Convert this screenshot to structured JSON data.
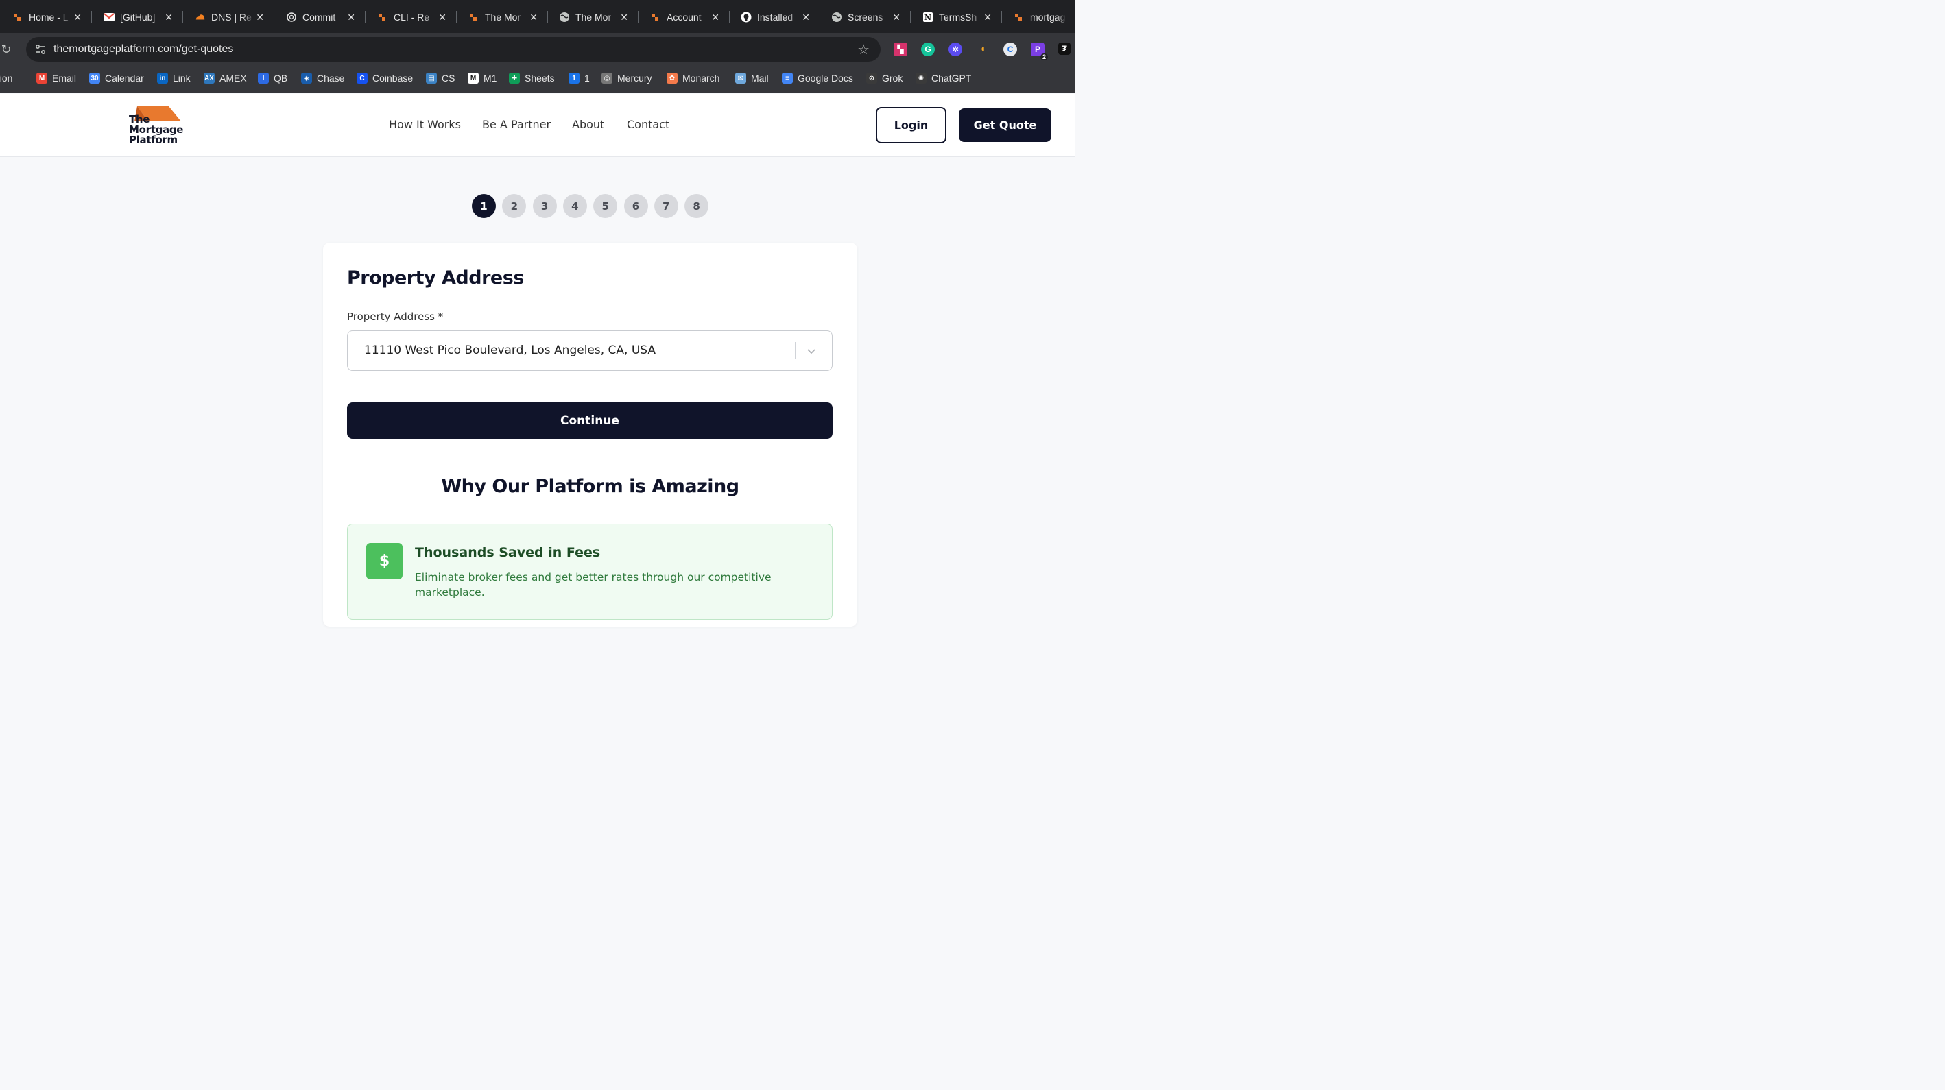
{
  "browser": {
    "tabs": [
      {
        "title": "Home - L",
        "icon": "orange-logo-icon"
      },
      {
        "title": "[GitHub]",
        "icon": "gmail-icon"
      },
      {
        "title": "DNS | Re",
        "icon": "cloudflare-icon"
      },
      {
        "title": "Commit",
        "icon": "openai-icon"
      },
      {
        "title": "CLI - Re",
        "icon": "orange-logo-icon"
      },
      {
        "title": "The Mor",
        "icon": "orange-logo-icon"
      },
      {
        "title": "The Mor",
        "icon": "globe-icon"
      },
      {
        "title": "Account",
        "icon": "orange-logo-icon"
      },
      {
        "title": "Installed",
        "icon": "github-icon"
      },
      {
        "title": "Screens",
        "icon": "globe-icon"
      },
      {
        "title": "TermsSh",
        "icon": "notion-icon"
      },
      {
        "title": "mortgag",
        "icon": "orange-logo-icon"
      }
    ],
    "url": "themortgageplatform.com/get-quotes",
    "extension_badge": "2",
    "bookmarks": [
      {
        "label": "Notion",
        "icon": "notion-icon",
        "color": "#3a3a3a"
      },
      {
        "label": "Email",
        "icon": "gmail-icon",
        "color": "#ea4335"
      },
      {
        "label": "Calendar",
        "icon": "calendar-icon",
        "color": "#4285f4"
      },
      {
        "label": "Link",
        "icon": "linkedin-icon",
        "color": "#0a66c2"
      },
      {
        "label": "AMEX",
        "icon": "amex-icon",
        "color": "#2e77bc"
      },
      {
        "label": "QB",
        "icon": "qb-icon",
        "color": "#2d6ae3"
      },
      {
        "label": "Chase",
        "icon": "chase-icon",
        "color": "#1a5dab"
      },
      {
        "label": "Coinbase",
        "icon": "coinbase-icon",
        "color": "#1652f0"
      },
      {
        "label": "CS",
        "icon": "cs-icon",
        "color": "#3b82c4"
      },
      {
        "label": "M1",
        "icon": "m1-icon",
        "color": "#ffffff"
      },
      {
        "label": "Sheets",
        "icon": "sheets-icon",
        "color": "#0f9d58"
      },
      {
        "label": "1",
        "icon": "onepassword-icon",
        "color": "#1a73e8"
      },
      {
        "label": "Mercury",
        "icon": "mercury-icon",
        "color": "#777777"
      },
      {
        "label": "Monarch",
        "icon": "monarch-icon",
        "color": "#f47a4b"
      },
      {
        "label": "Mail",
        "icon": "mail-icon",
        "color": "#6fa8dc"
      },
      {
        "label": "Google Docs",
        "icon": "docs-icon",
        "color": "#4285f4"
      },
      {
        "label": "Grok",
        "icon": "grok-icon",
        "color": "#3a3a3a"
      },
      {
        "label": "ChatGPT",
        "icon": "openai-icon",
        "color": "#3a3a3a"
      }
    ]
  },
  "site": {
    "logo_lines": [
      "The",
      "Mortgage",
      "Platform"
    ],
    "nav": [
      "How It Works",
      "Be A Partner",
      "About",
      "Contact"
    ],
    "login_label": "Login",
    "quote_label": "Get Quote",
    "brand_color": "#10142a",
    "accent_color": "#e8792e"
  },
  "steps": {
    "items": [
      "1",
      "2",
      "3",
      "4",
      "5",
      "6",
      "7",
      "8"
    ],
    "current": 1
  },
  "form": {
    "title": "Property Address",
    "field_label": "Property Address *",
    "address_value": "11110 West Pico Boulevard, Los Angeles, CA, USA",
    "continue_label": "Continue"
  },
  "why": {
    "title": "Why Our Platform is Amazing",
    "feature": {
      "icon_glyph": "$",
      "title": "Thousands Saved in Fees",
      "description": "Eliminate broker fees and get better rates through our competitive marketplace."
    }
  }
}
